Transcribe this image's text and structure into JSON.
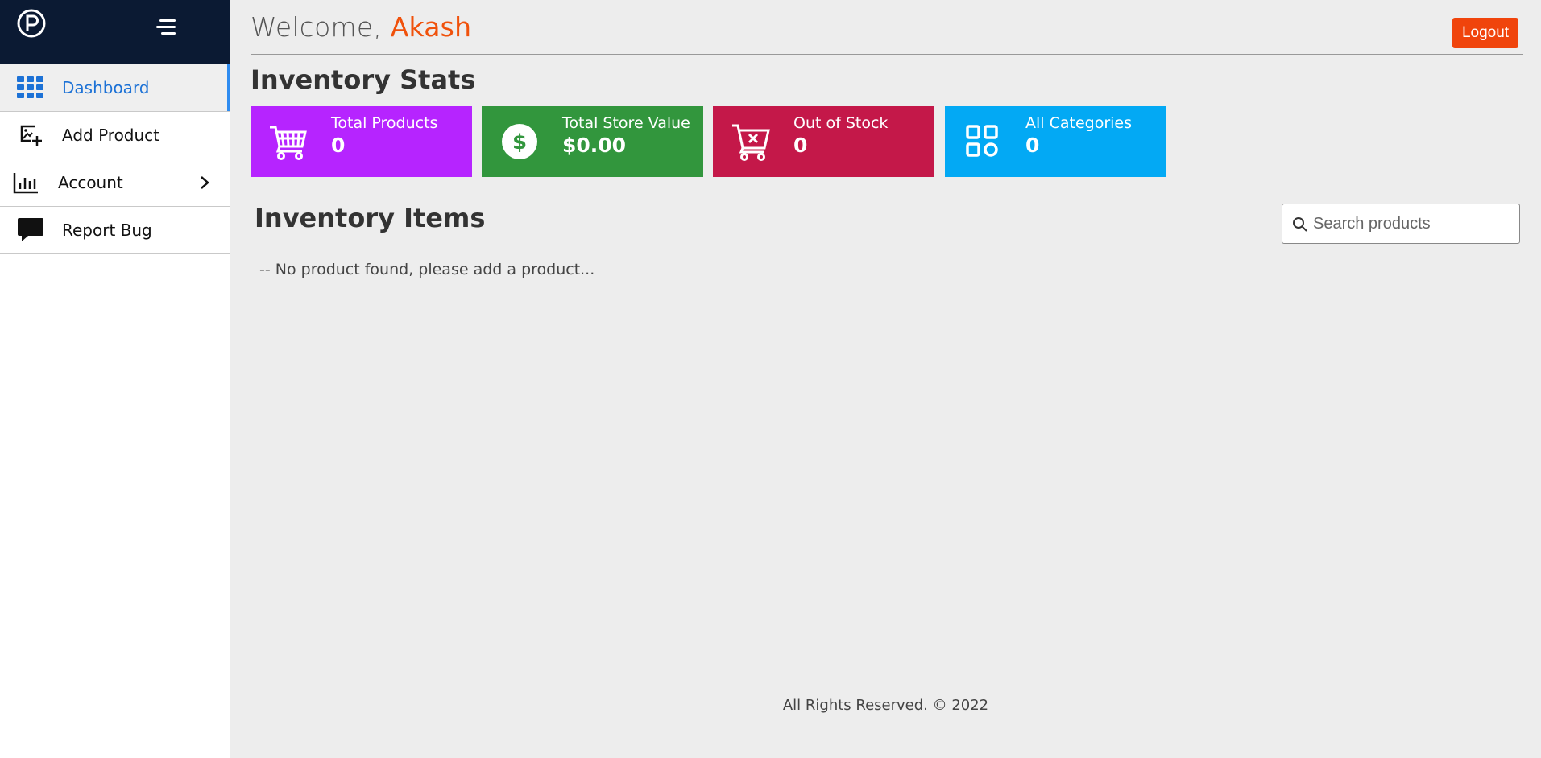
{
  "sidebar": {
    "logo_icon": "p-circle-logo",
    "menu_icon": "hamburger-menu-icon",
    "items": [
      {
        "label": "Dashboard",
        "icon": "grid-icon",
        "active": true
      },
      {
        "label": "Add Product",
        "icon": "add-image-icon"
      },
      {
        "label": "Account",
        "icon": "bar-chart-icon",
        "has_submenu": true
      },
      {
        "label": "Report Bug",
        "icon": "chat-bubble-icon"
      }
    ]
  },
  "header": {
    "welcome_prefix": "Welcome,",
    "user_name": "Akash",
    "logout_label": "Logout"
  },
  "stats": {
    "title": "Inventory Stats",
    "cards": [
      {
        "label": "Total Products",
        "value": "0",
        "color": "#b624ff",
        "icon": "cart-icon"
      },
      {
        "label": "Total Store Value",
        "value": "$0.00",
        "color": "#32963d",
        "icon": "dollar-circle-icon"
      },
      {
        "label": "Out of Stock",
        "value": "0",
        "color": "#c41849",
        "icon": "cart-remove-icon"
      },
      {
        "label": "All Categories",
        "value": "0",
        "color": "#03a9f4",
        "icon": "categories-icon"
      }
    ]
  },
  "inventory": {
    "title": "Inventory Items",
    "search_placeholder": "Search products",
    "empty_message": "-- No product found, please add a product..."
  },
  "footer": {
    "text": "All Rights Reserved. © 2022"
  },
  "colors": {
    "sidebar_header": "#0b1a33",
    "accent_orange": "#f0510b",
    "active_blue": "#2f8cf0"
  }
}
